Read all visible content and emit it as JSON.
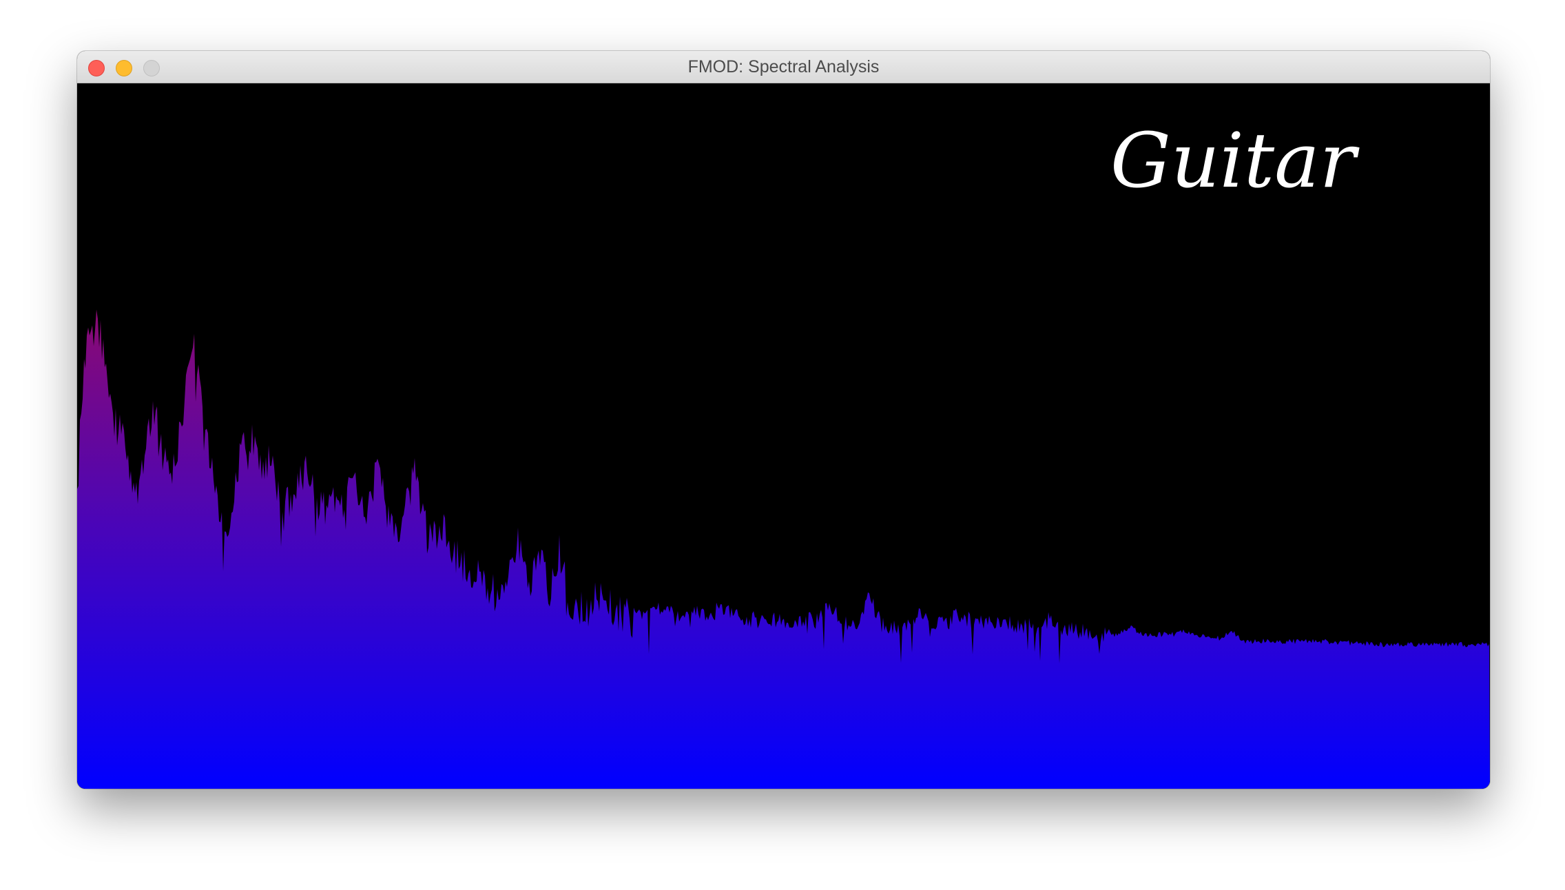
{
  "window": {
    "title": "FMOD: Spectral Analysis"
  },
  "content": {
    "label": "Guitar"
  },
  "colors": {
    "background": "#000000",
    "spectrum_top": "#8b0a72",
    "spectrum_mid": "#4a05b8",
    "spectrum_bottom": "#0000ff"
  }
}
